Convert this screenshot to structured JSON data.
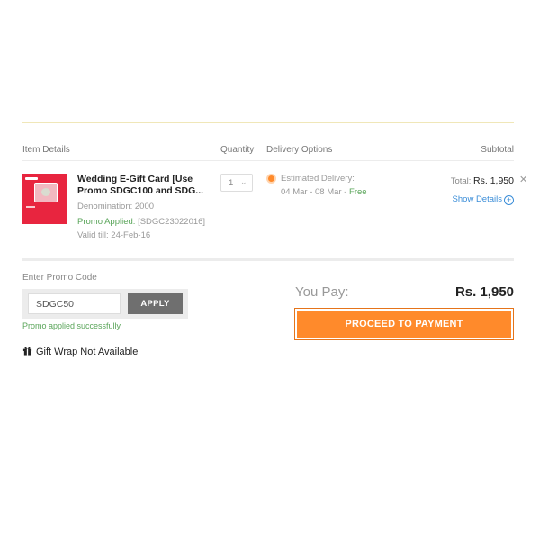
{
  "table_header": {
    "item_details": "Item Details",
    "quantity": "Quantity",
    "delivery_options": "Delivery Options",
    "subtotal": "Subtotal"
  },
  "item": {
    "title": "Wedding E-Gift Card [Use Promo SDGC100 and SDG...",
    "denomination": "Denomination: 2000",
    "promo_applied_label": "Promo Applied:",
    "promo_applied_code": "[SDGC23022016]",
    "valid_till": "Valid till: 24-Feb-16",
    "quantity": "1",
    "estimated_delivery_label": "Estimated Delivery:",
    "delivery_dates": "04 Mar - 08 Mar -",
    "delivery_cost": "Free",
    "total_label": "Total:",
    "total_amount": "Rs. 1,950",
    "show_details": "Show Details"
  },
  "promo": {
    "label": "Enter Promo Code",
    "input_value": "SDGC50",
    "apply_label": "APPLY",
    "success_message": "Promo applied successfully"
  },
  "gift_wrap": {
    "text": "Gift Wrap Not Available",
    "icon": "gift-icon"
  },
  "payment": {
    "you_pay_label": "You Pay:",
    "amount": "Rs. 1,950",
    "proceed_label": "PROCEED TO PAYMENT"
  },
  "colors": {
    "accent_orange": "#ff8a2b",
    "success_green": "#5aa55a",
    "link_blue": "#3a8dd8",
    "product_red": "#e8253f"
  }
}
